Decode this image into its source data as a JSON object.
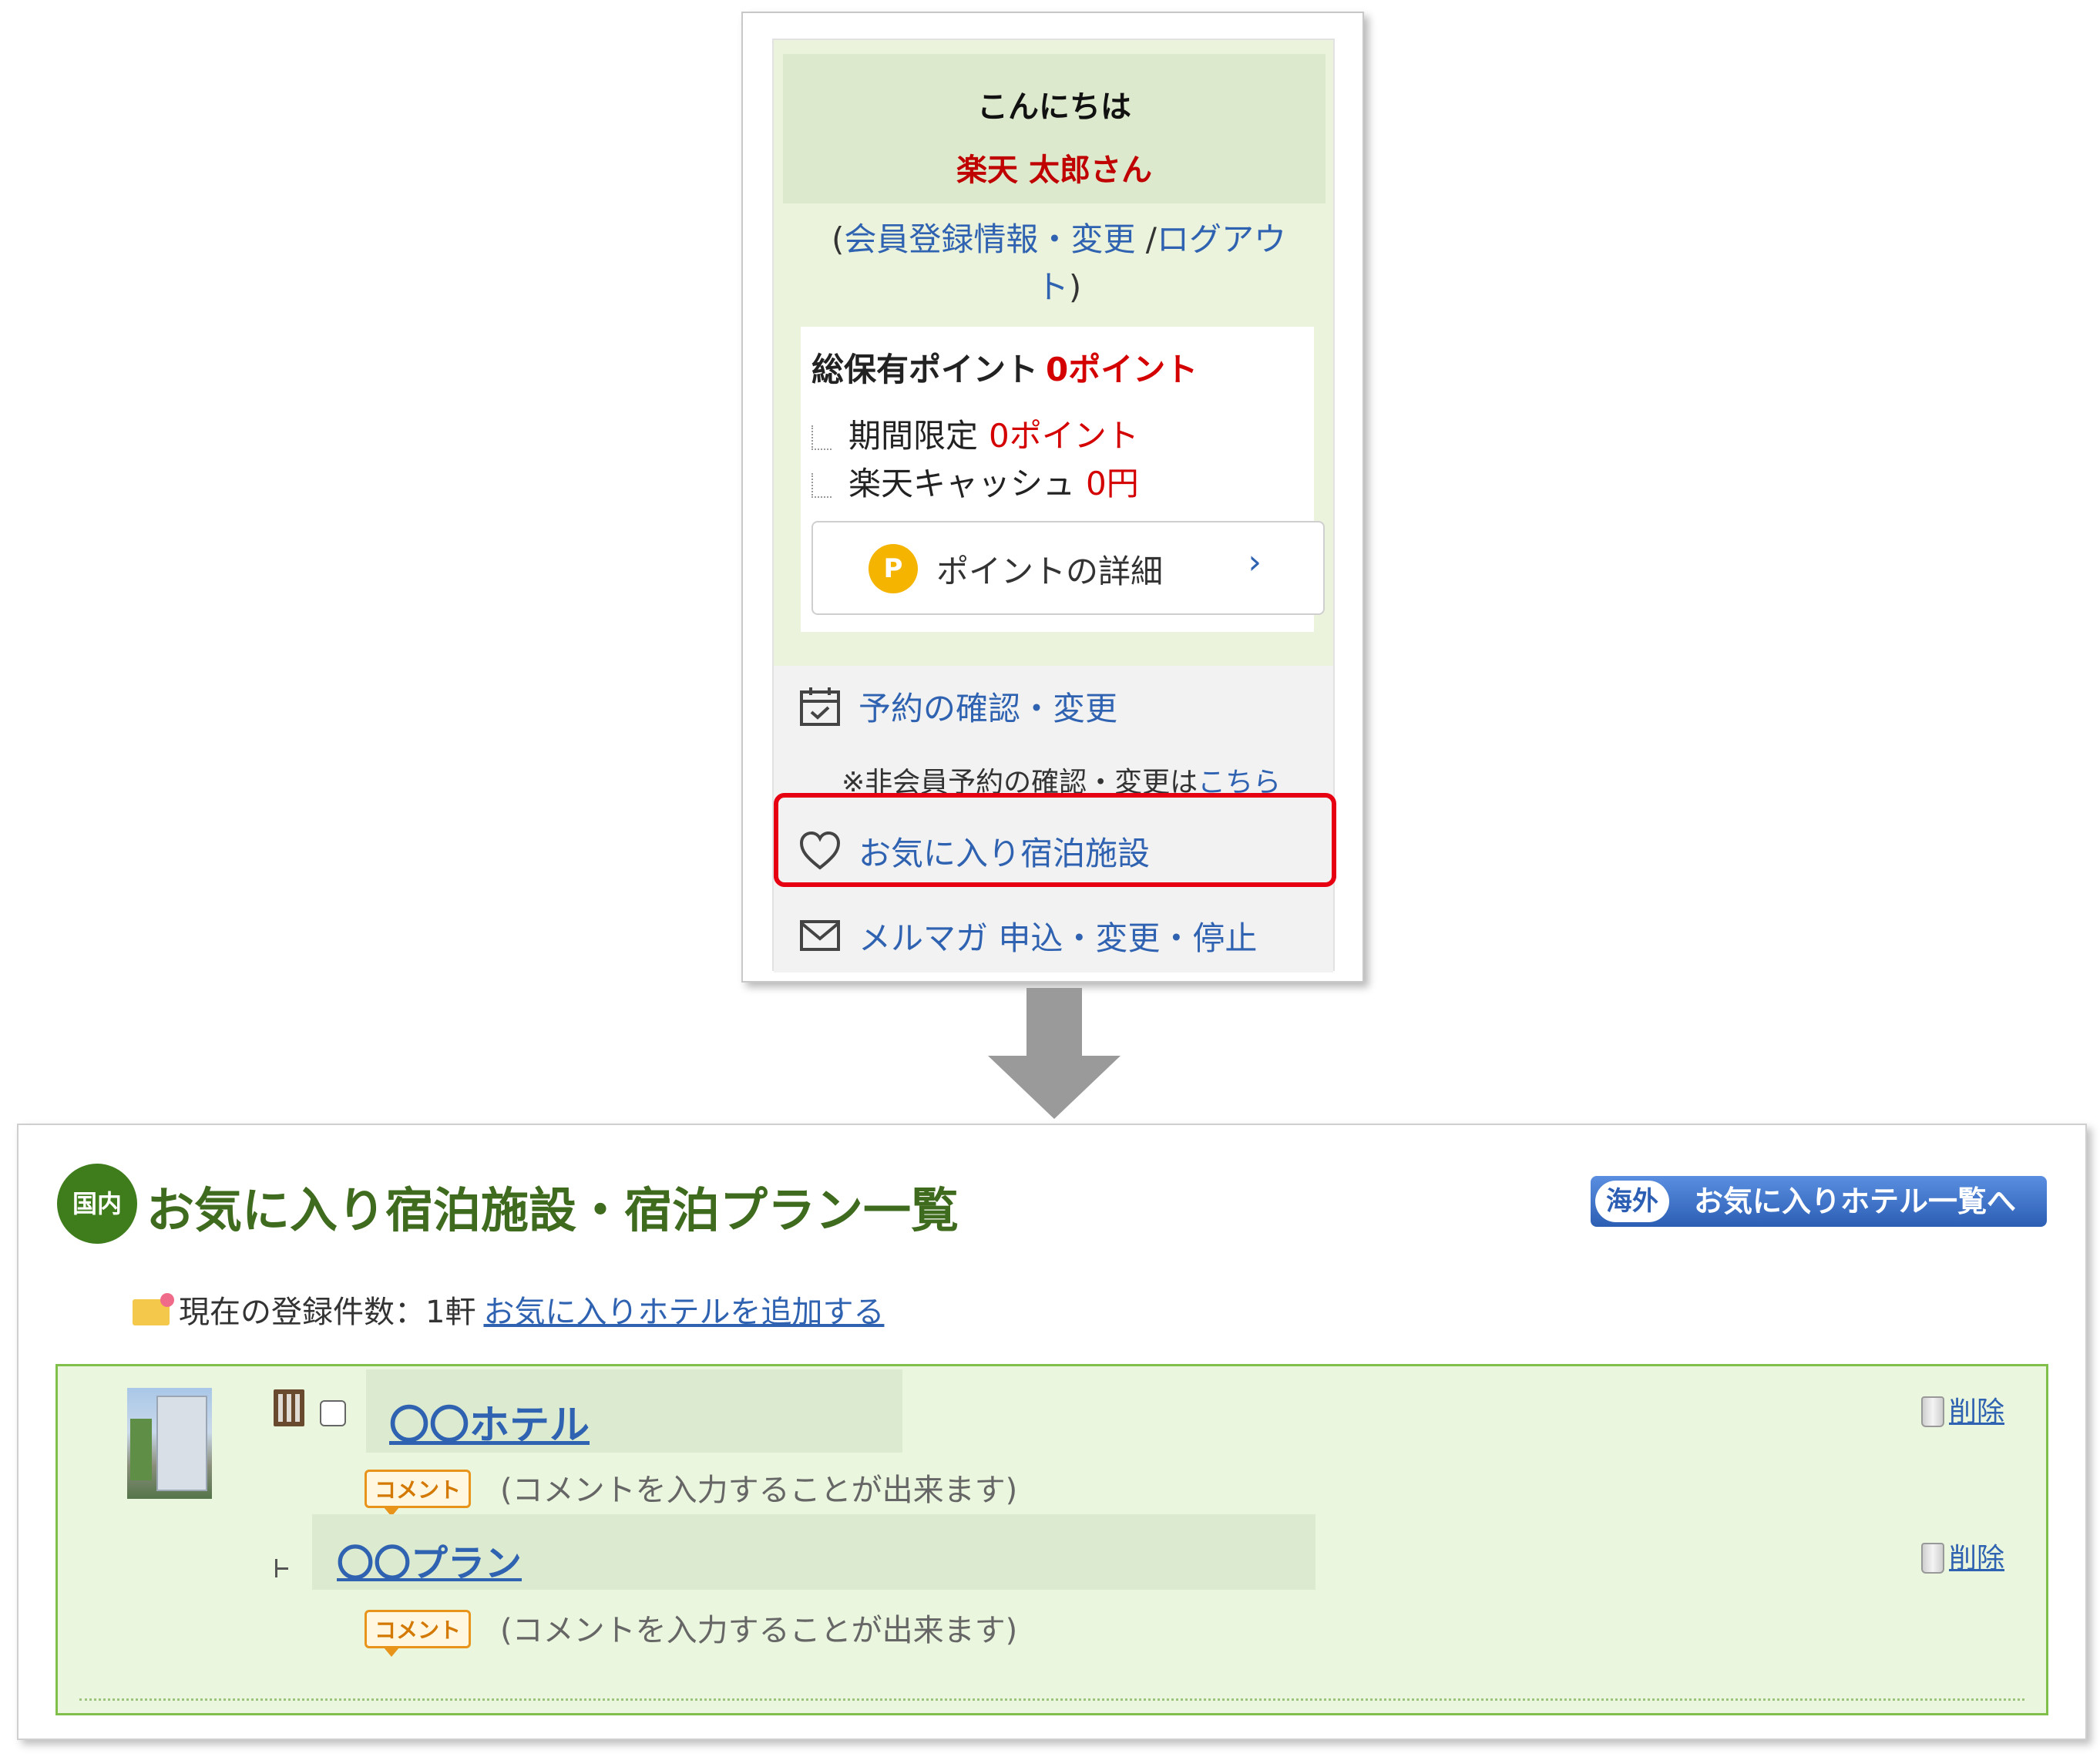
{
  "member_panel": {
    "greeting": "こんにちは",
    "user_name": "楽天 太郎さん",
    "links": {
      "open_paren": "(",
      "member_info": "会員登録情報・変更",
      "separator": " /",
      "logout": "ログアウト",
      "close_paren": ")"
    },
    "points": {
      "total_label": "総保有ポイント",
      "total_value": "0ポイント",
      "limited_label": "期間限定",
      "limited_value": "0ポイント",
      "cash_label": "楽天キャッシュ",
      "cash_value": "0円",
      "detail_button_icon_letter": "P",
      "detail_button_label": "ポイントの詳細",
      "detail_button_chevron": "›"
    },
    "menu": {
      "reservation_label": "予約の確認・変更",
      "non_member_note": "※非会員予約の確認・変更は",
      "non_member_link": "こちら",
      "favorites_label": "お気に入り宿泊施設",
      "newsletter_label": "メルマガ 申込・変更・停止"
    },
    "highlight_color": "#e60012"
  },
  "favorites_page": {
    "domestic_badge": "国内",
    "title": "お気に入り宿泊施設・宿泊プラン一覧",
    "overseas_tag": "海外",
    "overseas_button": "お気に入りホテル一覧へ",
    "count_label": "現在の登録件数：1軒",
    "add_link": "お気に入りホテルを追加する",
    "items": [
      {
        "name": "〇〇ホテル",
        "comment_tag": "コメント",
        "comment": "(コメントを入力することが出来ます)",
        "delete_label": "削除"
      },
      {
        "name": "〇〇プラン",
        "comment_tag": "コメント",
        "comment": "(コメントを入力することが出来ます)",
        "delete_label": "削除"
      }
    ]
  },
  "colors": {
    "link": "#2f62b0",
    "points_red": "#d40000",
    "title_green": "#3f6b1e",
    "list_background": "#eaf6dd",
    "list_border": "#7fbf4a"
  }
}
